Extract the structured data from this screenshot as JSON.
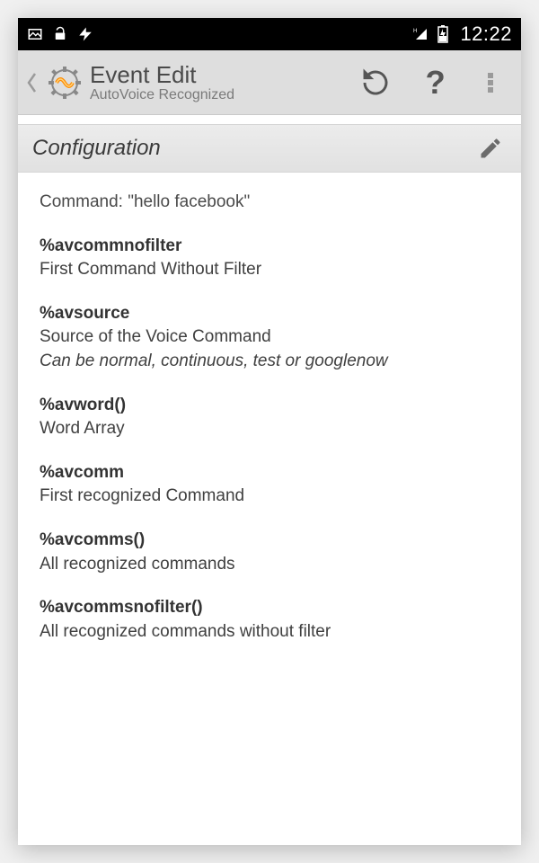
{
  "statusbar": {
    "clock": "12:22"
  },
  "appbar": {
    "title": "Event Edit",
    "subtitle": "AutoVoice Recognized"
  },
  "section": {
    "title": "Configuration"
  },
  "content": {
    "command_line": "Command: \"hello facebook\"",
    "variables": [
      {
        "name": "%avcommnofilter",
        "desc": "First Command Without Filter",
        "note": ""
      },
      {
        "name": "%avsource",
        "desc": "Source of the Voice Command",
        "note": "Can be normal, continuous, test or googlenow"
      },
      {
        "name": "%avword()",
        "desc": "Word Array",
        "note": ""
      },
      {
        "name": "%avcomm",
        "desc": "First recognized Command",
        "note": ""
      },
      {
        "name": "%avcomms()",
        "desc": "All recognized commands",
        "note": ""
      },
      {
        "name": "%avcommsnofilter()",
        "desc": "All recognized commands without filter",
        "note": ""
      }
    ]
  }
}
